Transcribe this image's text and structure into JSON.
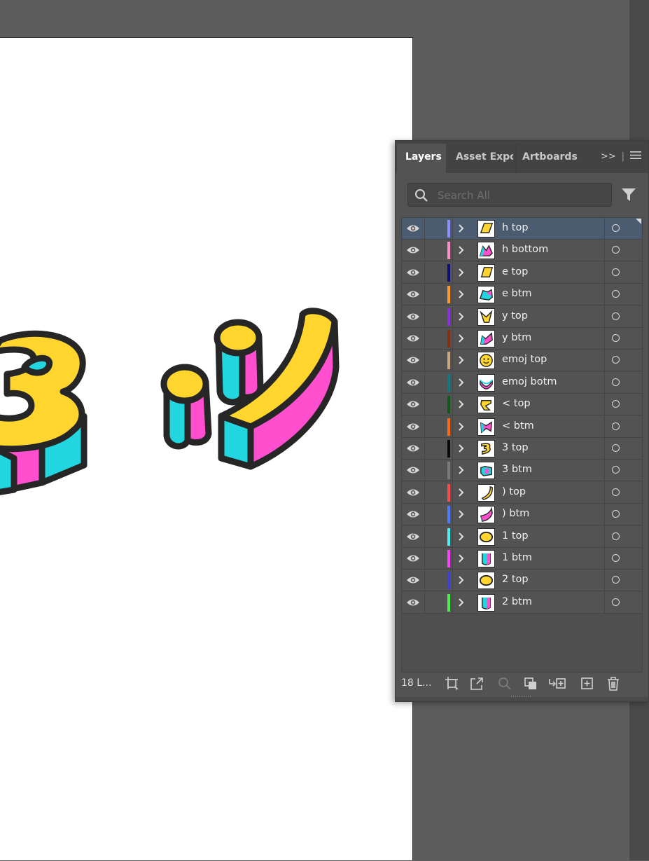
{
  "panel": {
    "tabs": [
      "Layers",
      "Asset Expor",
      "Artboards"
    ],
    "overflow_glyph": ">>",
    "search_placeholder": "Search All",
    "footer_count": "18 L..."
  },
  "layers": [
    {
      "name": "h top",
      "color": "#8f8fff",
      "selected": true
    },
    {
      "name": "h bottom",
      "color": "#ff8fc8",
      "selected": false
    },
    {
      "name": "e top",
      "color": "#0c0c7a",
      "selected": false
    },
    {
      "name": "e btm",
      "color": "#ff9a2a",
      "selected": false
    },
    {
      "name": "y top",
      "color": "#8b2fe0",
      "selected": false
    },
    {
      "name": "y btm",
      "color": "#8a2e12",
      "selected": false
    },
    {
      "name": "emoj top",
      "color": "#c9a77e",
      "selected": false
    },
    {
      "name": "emoj botm",
      "color": "#0f7b80",
      "selected": false
    },
    {
      "name": "< top",
      "color": "#0f5a18",
      "selected": false
    },
    {
      "name": "< btm",
      "color": "#ff6a10",
      "selected": false
    },
    {
      "name": "3 top",
      "color": "#0a0a0a",
      "selected": false
    },
    {
      "name": "3 btm",
      "color": "#7a7a7a",
      "selected": false
    },
    {
      "name": ") top",
      "color": "#ff4a4a",
      "selected": false
    },
    {
      "name": ") btm",
      "color": "#4a7aff",
      "selected": false
    },
    {
      "name": "1 top",
      "color": "#4af0f0",
      "selected": false
    },
    {
      "name": "1 btm",
      "color": "#ff40ff",
      "selected": false
    },
    {
      "name": "2 top",
      "color": "#4040d0",
      "selected": false
    },
    {
      "name": "2 btm",
      "color": "#4af04a",
      "selected": false
    }
  ],
  "colors": {
    "yellow": "#ffd52e",
    "cyan": "#22d6e0",
    "magenta": "#ff4fcf",
    "stroke": "#262626"
  }
}
